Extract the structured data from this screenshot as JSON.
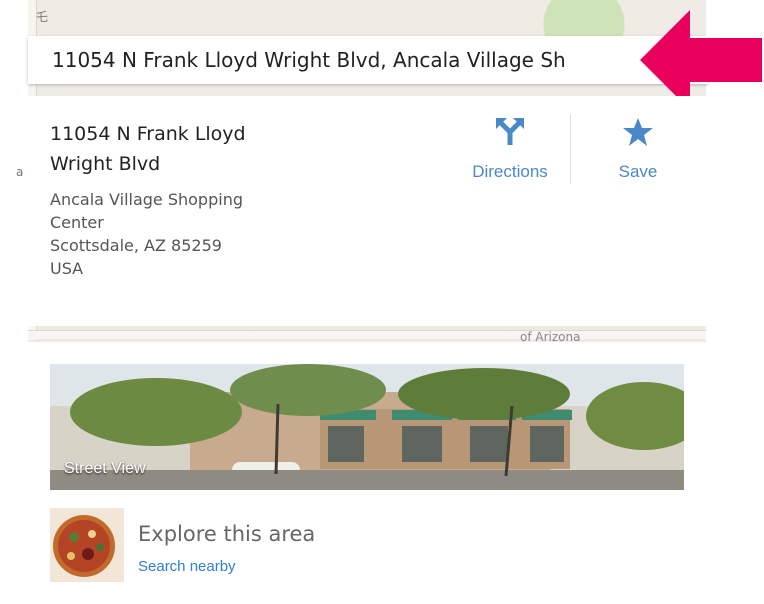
{
  "map": {
    "top_label": "乇",
    "left_label": "a S",
    "bottom_label": "of Arizona"
  },
  "search": {
    "value": "11054 N Frank Lloyd Wright Blvd, Ancala Village Sh"
  },
  "place": {
    "title": "11054 N Frank Lloyd\nWright Blvd",
    "address_lines": [
      "Ancala Village Shopping",
      "Center",
      "Scottsdale, AZ 85259",
      "USA"
    ]
  },
  "actions": {
    "directions_label": "Directions",
    "save_label": "Save"
  },
  "street_view": {
    "label": "Street View"
  },
  "explore": {
    "title": "Explore this area",
    "link_label": "Search nearby"
  },
  "colors": {
    "accent": "#4b88c8",
    "link": "#2f7ed8",
    "arrow": "#e8005c"
  }
}
